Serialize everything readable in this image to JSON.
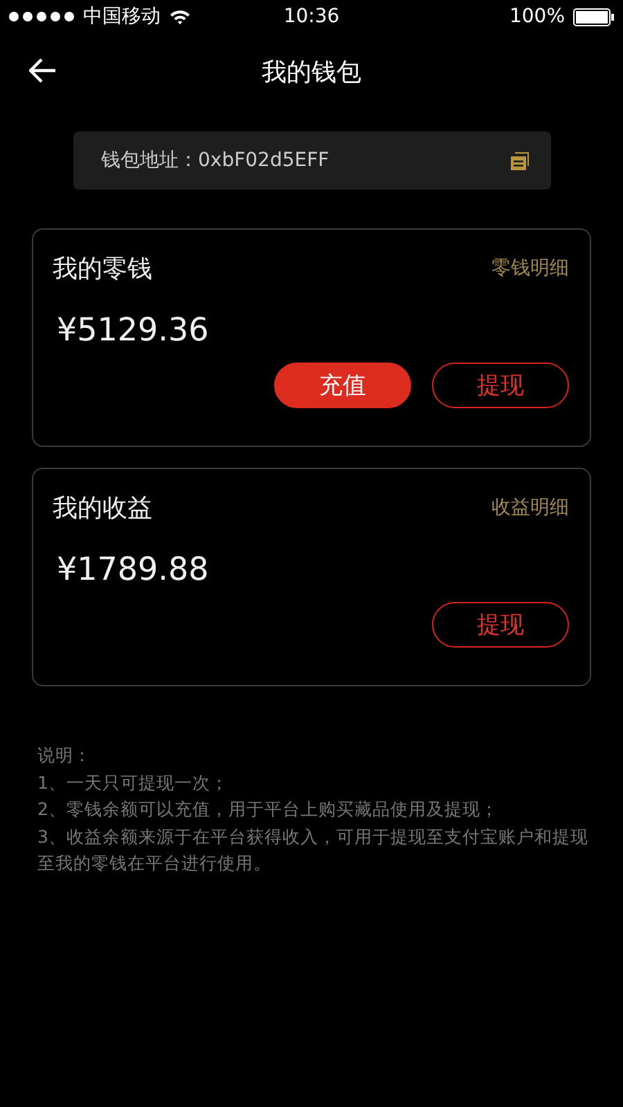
{
  "status_bar": {
    "carrier": "中国移动",
    "time": "10:36",
    "battery": "100%"
  },
  "header": {
    "title": "我的钱包"
  },
  "address": {
    "label": "钱包地址：0xbF02d5EFF"
  },
  "cards": [
    {
      "title": "我的零钱",
      "link": "零钱明细",
      "amount": "¥5129.36",
      "buttons": [
        {
          "label": "充值",
          "kind": "filled"
        },
        {
          "label": "提现",
          "kind": "outline"
        }
      ]
    },
    {
      "title": "我的收益",
      "link": "收益明细",
      "amount": "¥1789.88",
      "buttons": [
        {
          "label": "提现",
          "kind": "outline"
        }
      ]
    }
  ],
  "notes": [
    "说明：",
    "1、一天只可提现一次；",
    "2、零钱余额可以充值，用于平台上购买藏品使用及提现；",
    "3、收益余额来源于在平台获得收入，可用于提现至支付宝账户和提现至我的零钱在平台进行使用。"
  ]
}
